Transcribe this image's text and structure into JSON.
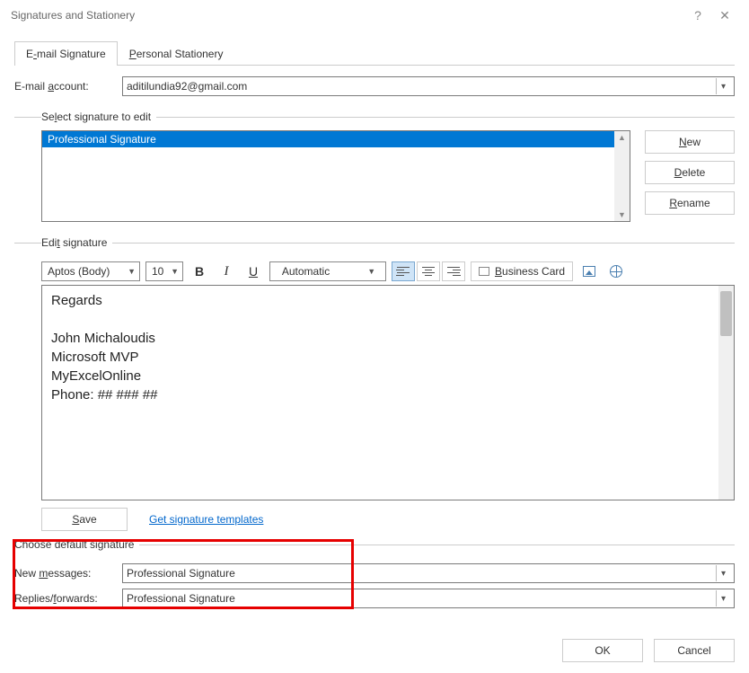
{
  "titlebar": {
    "title": "Signatures and Stationery"
  },
  "tabs": {
    "email_pre": "E",
    "email_u": "-",
    "email_post": "mail Signature",
    "personal_pre": "",
    "personal_u": "P",
    "personal_post": "ersonal Stationery"
  },
  "account": {
    "label_pre": "E-mail ",
    "label_u": "a",
    "label_post": "ccount:",
    "value": "aditilundia92@gmail.com"
  },
  "select_sig": {
    "legend_pre": "Se",
    "legend_u": "l",
    "legend_post": "ect signature to edit",
    "items": [
      "Professional Signature"
    ]
  },
  "sidebtns": {
    "new_u": "N",
    "new_post": "ew",
    "del_u": "D",
    "del_post": "elete",
    "ren_u": "R",
    "ren_post": "ename"
  },
  "edit": {
    "legend_pre": "Edi",
    "legend_u": "t",
    "legend_post": " signature",
    "font": "Aptos (Body)",
    "size": "10",
    "color": "Automatic",
    "bcard_pre": "",
    "bcard_u": "B",
    "bcard_post": "usiness Card",
    "body_line1": "Regards",
    "body_line3": "John Michaloudis",
    "body_line4": "Microsoft MVP",
    "body_line5": "MyExcelOnline",
    "body_line6": "Phone: ## ### ##"
  },
  "save": {
    "btn_u": "S",
    "btn_post": "ave",
    "link": "Get signature templates"
  },
  "defaults": {
    "legend": "Choose default signature",
    "newmsg_pre": "New ",
    "newmsg_u": "m",
    "newmsg_post": "essages:",
    "reply_pre": "Replies/",
    "reply_u": "f",
    "reply_post": "orwards:",
    "newmsg_val": "Professional Signature",
    "reply_val": "Professional Signature"
  },
  "footer": {
    "ok": "OK",
    "cancel": "Cancel"
  }
}
